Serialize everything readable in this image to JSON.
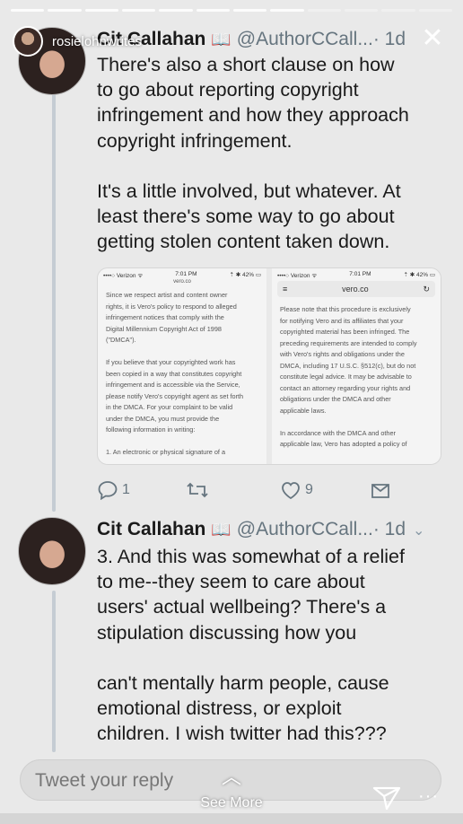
{
  "story": {
    "username": "rosielohnwrites",
    "close_icon": "close-icon"
  },
  "tweets": [
    {
      "name": "Cit Callahan",
      "book_icon": "📖",
      "handle": "@AuthorCCall...",
      "time": "· 1d",
      "text": "There's also a short clause on how\nto go about reporting copyright\ninfringement and how they approach\ncopyright infringement.\n\nIt's a little involved, but whatever. At\nleast there's some way to go about\ngetting stolen content taken down.",
      "media": [
        {
          "carrier": "••••○ Verizon ᯤ",
          "clock": "7:01 PM",
          "battery": "⇡ ✱ 42% ▭",
          "url": "vero.co",
          "text": "Since we respect artist and content owner\nrights, it is Vero's policy to respond to alleged\ninfringement notices that comply with the\nDigital Millennium Copyright Act of 1998\n(\"DMCA\").\n\nIf you believe that your copyrighted work has\nbeen copied in a way that constitutes copyright\ninfringement and is accessible via the Service,\nplease notify Vero's copyright agent as set forth\nin the DMCA. For your complaint to be valid\nunder the DMCA, you must provide the\nfollowing information in writing:\n\n        1. An electronic or physical signature of a"
        },
        {
          "carrier": "••••○ Verizon ᯤ",
          "clock": "7:01 PM",
          "battery": "⇡ ✱ 42% ▭",
          "url": "vero.co",
          "menu": "≡",
          "reload": "↻",
          "text": "Please note that this procedure is exclusively\nfor notifying Vero and its affiliates that your\ncopyrighted material has been infringed. The\npreceding requirements are intended to comply\nwith Vero's rights and obligations under the\nDMCA, including 17 U.S.C. §512(c), but do not\nconstitute legal advice. It may be advisable to\ncontact an attorney regarding your rights and\nobligations under the DMCA and other\napplicable laws.\n\nIn accordance with the DMCA and other\napplicable law, Vero has adopted a policy of"
        }
      ],
      "actions": {
        "reply_count": "1",
        "retweet_count": "",
        "like_count": "9"
      }
    },
    {
      "name": "Cit Callahan",
      "book_icon": "📖",
      "handle": "@AuthorCCall...",
      "time": "· 1d",
      "caret": "⌄",
      "text": "3. And this was somewhat of a relief\nto me--they seem to care about\nusers' actual wellbeing? There's a\nstipulation discussing how you\n\ncan't mentally harm people, cause\nemotional distress, or exploit\nchildren. I wish twitter had this???"
    }
  ],
  "reply": {
    "placeholder": "Tweet your reply"
  },
  "see_more": {
    "chevron": "︿",
    "label": "See More"
  },
  "more_glyph": "···",
  "colors": {
    "background": "#e9e9e9",
    "thread_line": "#c5ccd3",
    "secondary_text": "#66757f"
  }
}
